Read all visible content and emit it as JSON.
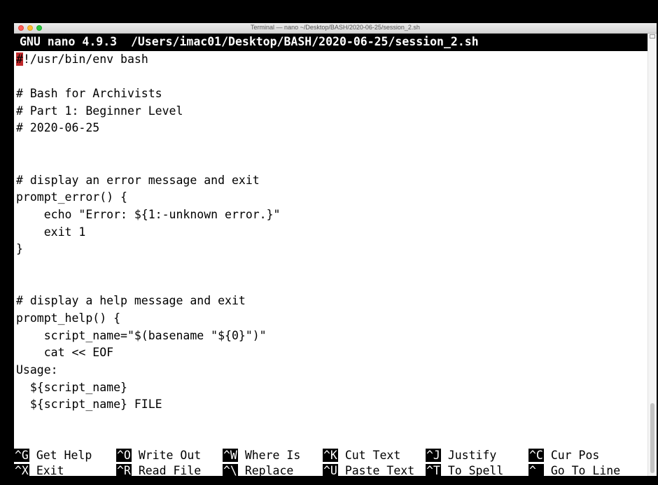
{
  "window": {
    "title": "Terminal — nano ~/Desktop/BASH/2020-06-25/session_2.sh"
  },
  "nano": {
    "status": "GNU nano 4.9.3  /Users/imac01/Desktop/BASH/2020-06-25/session_2.sh"
  },
  "editor": {
    "cursor_char": "#",
    "first_line_rest": "!/usr/bin/env bash",
    "lines": [
      "",
      "# Bash for Archivists",
      "# Part 1: Beginner Level",
      "# 2020-06-25",
      "",
      "",
      "# display an error message and exit",
      "prompt_error() {",
      "    echo \"Error: ${1:-unknown error.}\"",
      "    exit 1",
      "}",
      "",
      "",
      "# display a help message and exit",
      "prompt_help() {",
      "    script_name=\"$(basename \"${0}\")\"",
      "    cat << EOF",
      "Usage:",
      "  ${script_name}",
      "  ${script_name} FILE"
    ]
  },
  "shortcuts": {
    "row1": [
      {
        "key": "^G",
        "label": "Get Help"
      },
      {
        "key": "^O",
        "label": "Write Out"
      },
      {
        "key": "^W",
        "label": "Where Is"
      },
      {
        "key": "^K",
        "label": "Cut Text"
      },
      {
        "key": "^J",
        "label": "Justify"
      },
      {
        "key": "^C",
        "label": "Cur Pos"
      }
    ],
    "row2": [
      {
        "key": "^X",
        "label": "Exit"
      },
      {
        "key": "^R",
        "label": "Read File"
      },
      {
        "key": "^\\",
        "label": "Replace"
      },
      {
        "key": "^U",
        "label": "Paste Text"
      },
      {
        "key": "^T",
        "label": "To Spell"
      },
      {
        "key": "^_",
        "label": "Go To Line"
      }
    ]
  }
}
